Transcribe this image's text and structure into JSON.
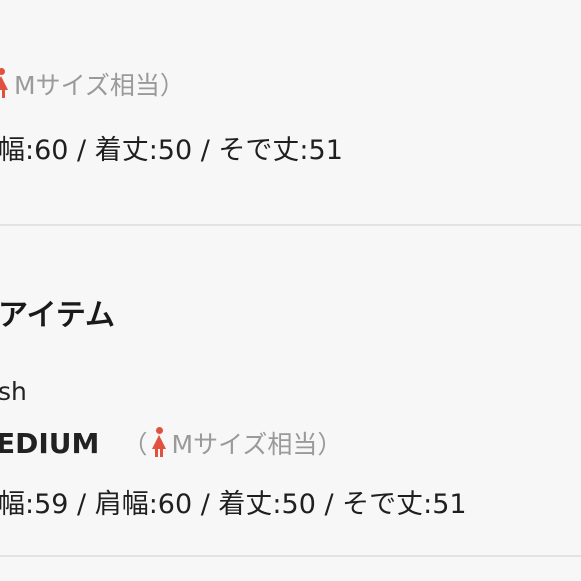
{
  "section_top": {
    "size_note": "Mサイズ相当）",
    "measurements": "幅:60 / 着丈:50 / そで丈:51"
  },
  "section_bottom": {
    "heading": "アイテム",
    "brand": "sh",
    "size_label": "EDIUM",
    "size_note_open": "（",
    "size_note": "Mサイズ相当）",
    "measurements": "幅:59 / 肩幅:60 / 着丈:50 / そで丈:51"
  },
  "colors": {
    "person_icon": "#e0523f"
  },
  "icons": {
    "size_person": "person-icon"
  }
}
